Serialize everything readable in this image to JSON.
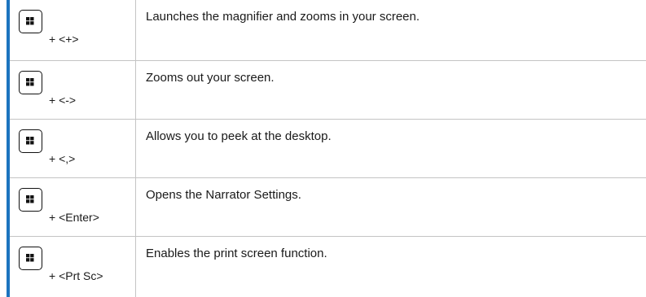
{
  "colors": {
    "accent_rule": "#1b74bf",
    "grid_lines": "#c4c4c4"
  },
  "icons": {
    "key_icon": "windows-key-icon"
  },
  "shortcuts": [
    {
      "keys": "+ <+>",
      "description": "Launches the magnifier and zooms in your screen."
    },
    {
      "keys": "+ <->",
      "description": "Zooms out your screen."
    },
    {
      "keys": "+ <,>",
      "description": "Allows you to peek at the desktop."
    },
    {
      "keys": "+ <Enter>",
      "description": "Opens the Narrator Settings."
    },
    {
      "keys": "+ <Prt Sc>",
      "description": "Enables the print screen function."
    }
  ]
}
